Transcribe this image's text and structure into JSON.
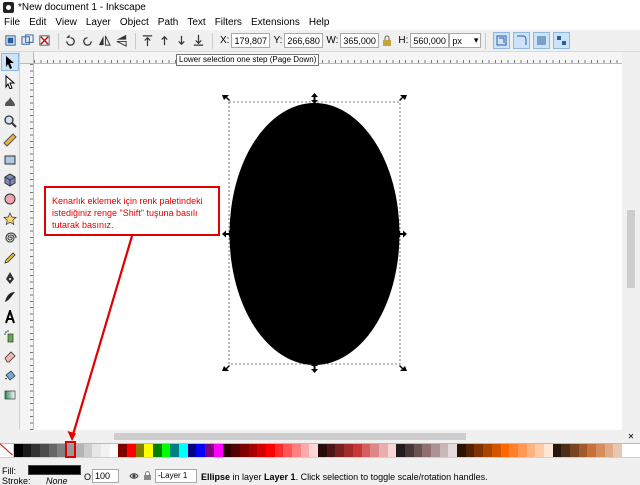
{
  "window": {
    "title": "*New document 1 - Inkscape"
  },
  "menu": [
    "File",
    "Edit",
    "View",
    "Layer",
    "Object",
    "Path",
    "Text",
    "Filters",
    "Extensions",
    "Help"
  ],
  "toolbar": {
    "x_label": "X:",
    "x_value": "179,807",
    "y_label": "Y:",
    "y_value": "266,680",
    "w_label": "W:",
    "w_value": "365,000",
    "h_label": "H:",
    "h_value": "560,000",
    "unit": "px",
    "tooltip": "Lower selection one step (Page Down)"
  },
  "tools": [
    "selector-tool",
    "node-tool",
    "tweak-tool",
    "zoom-tool",
    "measure-tool",
    "rect-tool",
    "3dbox-tool",
    "ellipse-tool",
    "star-tool",
    "spiral-tool",
    "pencil-tool",
    "pen-tool",
    "calligraphy-tool",
    "text-tool",
    "spray-tool",
    "eraser-tool",
    "paintbucket-tool",
    "gradient-tool"
  ],
  "annotation": {
    "line1": "Kenarlık eklemek için renk paletindeki",
    "line2": "istediğiniz renge \"Shift\" tuşuna basılı",
    "line3": "tutarak basınız.",
    "color": "#e10000"
  },
  "palette": {
    "colors": [
      "#000000",
      "#1a1a1a",
      "#333333",
      "#4d4d4d",
      "#666666",
      "#808080",
      "#999999",
      "#b3b3b3",
      "#cccccc",
      "#e6e6e6",
      "#f2f2f2",
      "#ffffff",
      "#800000",
      "#ff0000",
      "#808000",
      "#ffff00",
      "#008000",
      "#00ff00",
      "#008080",
      "#00ffff",
      "#000080",
      "#0000ff",
      "#800080",
      "#ff00ff",
      "#2b0000",
      "#550000",
      "#800000",
      "#aa0000",
      "#d40000",
      "#ff0000",
      "#ff2a2a",
      "#ff5555",
      "#ff8080",
      "#ffaaaa",
      "#ffd5d5",
      "#280b0b",
      "#501616",
      "#782121",
      "#a02c2c",
      "#c83737",
      "#d35f5f",
      "#de8787",
      "#e9afaf",
      "#f4d7d7",
      "#241c1c",
      "#483737",
      "#6c5353",
      "#916f6f",
      "#ac9393",
      "#c8b7b7",
      "#e3dbdb",
      "#2b1100",
      "#552200",
      "#803300",
      "#aa4400",
      "#d45500",
      "#ff6600",
      "#ff7f2a",
      "#ff9955",
      "#ffb380",
      "#ffccaa",
      "#ffe6d5",
      "#28170b",
      "#502d16",
      "#784421",
      "#a05a2c",
      "#c87137",
      "#d38d5f",
      "#deaa87",
      "#e9c6af"
    ]
  },
  "status": {
    "fill_label": "Fill:",
    "fill_color": "#000000",
    "stroke_label": "Stroke:",
    "stroke_value": "None",
    "opacity_label": "O:",
    "opacity_value": "100",
    "layer": "-Layer 1",
    "msg_object": "Ellipse",
    "msg_mid": " in layer ",
    "msg_layer": "Layer 1",
    "msg_tail": ". Click selection to toggle scale/rotation handles."
  }
}
